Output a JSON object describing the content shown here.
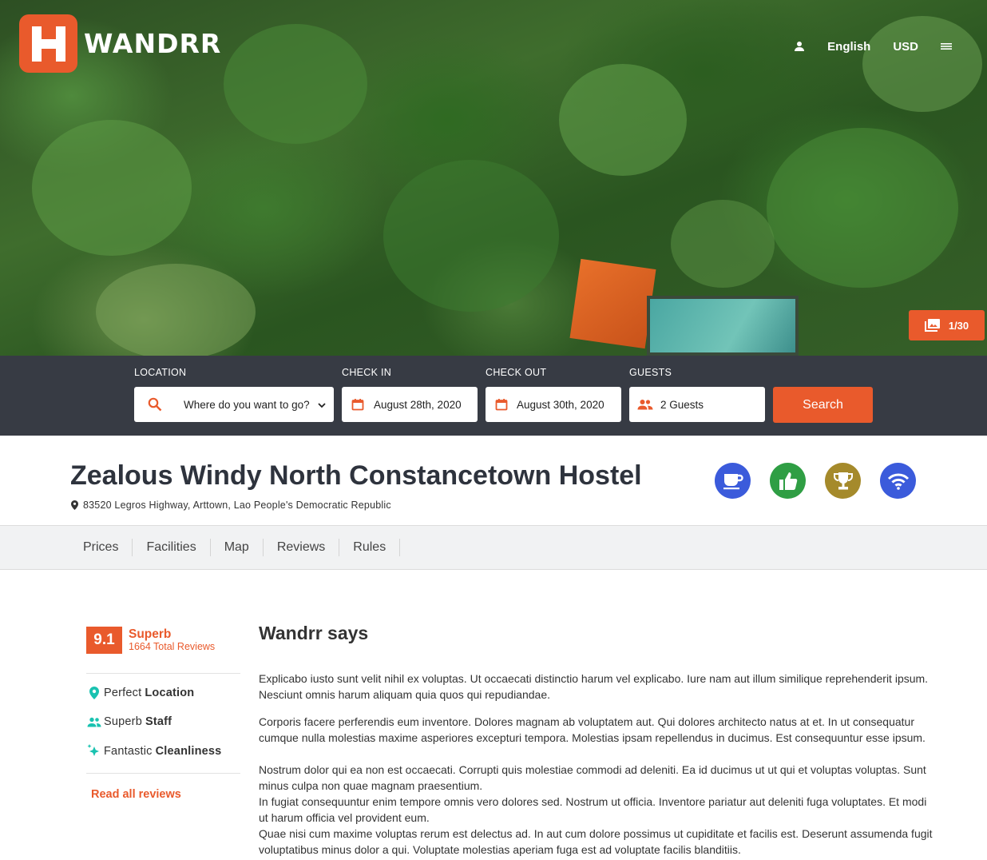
{
  "brand": {
    "name": "WANDRR",
    "logo_letter": "H",
    "accent": "#e95a2c"
  },
  "topnav": {
    "language": "English",
    "currency": "USD"
  },
  "gallery": {
    "counter": "1/30"
  },
  "search": {
    "location_label": "LOCATION",
    "location_value": "Where do you want to go?",
    "checkin_label": "CHECK IN",
    "checkin_value": "August 28th, 2020",
    "checkout_label": "CHECK OUT",
    "checkout_value": "August 30th, 2020",
    "guests_label": "GUESTS",
    "guests_value": "2 Guests",
    "button": "Search"
  },
  "property": {
    "title": "Zealous Windy North Constancetown Hostel",
    "address": "83520 Legros Highway, Arttown, Lao People's Democratic Republic",
    "badges": [
      {
        "icon": "coffee-cup-icon",
        "color": "#3b5bdb"
      },
      {
        "icon": "thumbs-up-icon",
        "color": "#2f9e44"
      },
      {
        "icon": "trophy-icon",
        "color": "#a58a2b"
      },
      {
        "icon": "wifi-icon",
        "color": "#3b5bdb"
      }
    ]
  },
  "tabs": [
    "Prices",
    "Facilities",
    "Map",
    "Reviews",
    "Rules"
  ],
  "rating": {
    "score": "9.1",
    "word": "Superb",
    "count": "1664 Total Reviews",
    "features": [
      {
        "icon": "location-pin-icon",
        "prefix": "Perfect",
        "strong": "Location"
      },
      {
        "icon": "people-icon",
        "prefix": "Superb",
        "strong": "Staff"
      },
      {
        "icon": "sparkle-icon",
        "prefix": "Fantastic",
        "strong": "Cleanliness"
      }
    ],
    "read_all": "Read all reviews"
  },
  "main": {
    "heading": "Wandrr says",
    "p1": "Explicabo iusto sunt velit nihil ex voluptas. Ut occaecati distinctio harum vel explicabo. Iure nam aut illum similique reprehenderit ipsum. Nesciunt omnis harum aliquam quia quos qui repudiandae.",
    "p2": "Corporis facere perferendis eum inventore. Dolores magnam ab voluptatem aut. Qui dolores architecto natus at et. In ut consequatur cumque nulla molestias maxime asperiores excepturi tempora. Molestias ipsam repellendus in ducimus. Est consequuntur esse ipsum.",
    "p3": "Nostrum dolor qui ea non est occaecati. Corrupti quis molestiae commodi ad deleniti. Ea id ducimus ut ut qui et voluptas voluptas. Sunt minus culpa non quae magnam praesentium.",
    "p4": "In fugiat consequuntur enim tempore omnis vero dolores sed. Nostrum ut officia. Inventore pariatur aut deleniti fuga voluptates. Et modi ut harum officia vel provident eum.",
    "p5": "Quae nisi cum maxime voluptas rerum est delectus ad. In aut cum dolore possimus ut cupiditate et facilis est. Deserunt assumenda fugit voluptatibus minus dolor a qui. Voluptate molestias aperiam fuga est ad voluptate facilis blanditiis."
  }
}
